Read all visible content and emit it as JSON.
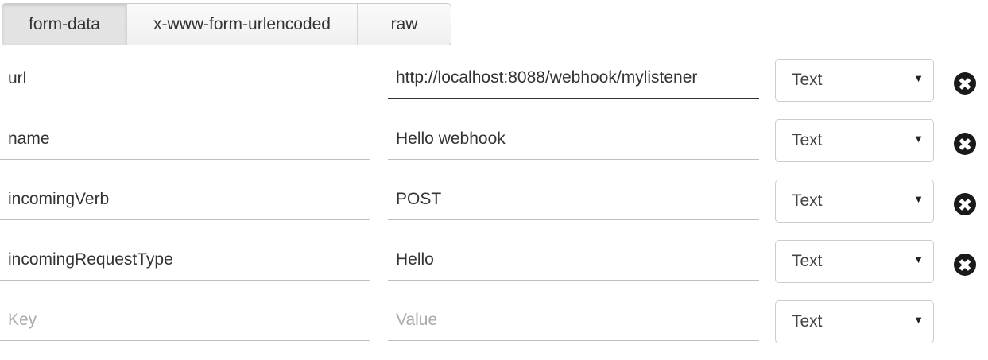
{
  "tabs": [
    {
      "label": "form-data",
      "active": true
    },
    {
      "label": "x-www-form-urlencoded",
      "active": false
    },
    {
      "label": "raw",
      "active": false
    }
  ],
  "rows": [
    {
      "key": "url",
      "value": "http://localhost:8088/webhook/mylistener",
      "type": "Text"
    },
    {
      "key": "name",
      "value": "Hello webhook",
      "type": "Text"
    },
    {
      "key": "incomingVerb",
      "value": "POST",
      "type": "Text"
    },
    {
      "key": "incomingRequestType",
      "value": "Hello",
      "type": "Text"
    }
  ],
  "new_row": {
    "key_placeholder": "Key",
    "value_placeholder": "Value",
    "type": "Text"
  },
  "icons": {
    "select_caret": "caret-down-icon",
    "remove": "remove-circle-icon"
  }
}
